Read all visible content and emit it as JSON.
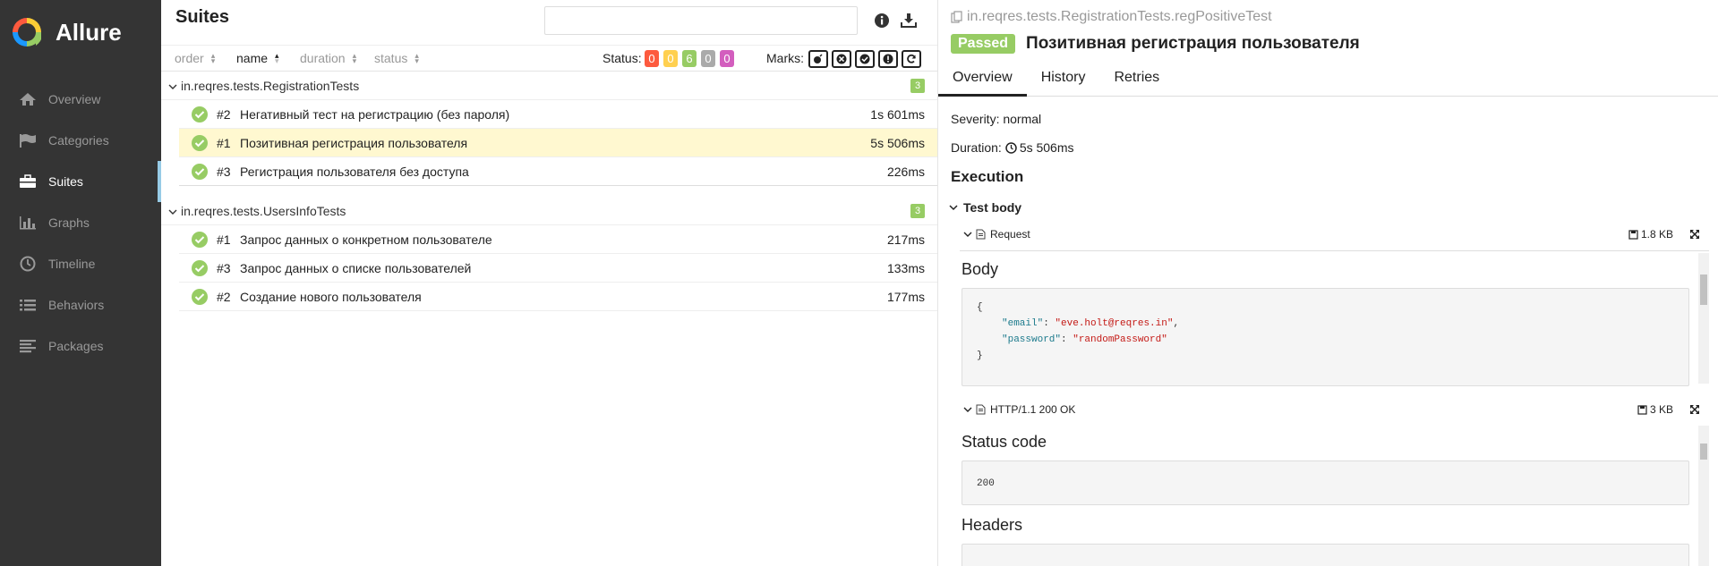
{
  "app": {
    "name": "Allure"
  },
  "sidebar": {
    "items": [
      {
        "label": "Overview",
        "icon": "home-icon"
      },
      {
        "label": "Categories",
        "icon": "flag-icon"
      },
      {
        "label": "Suites",
        "icon": "briefcase-icon",
        "active": true
      },
      {
        "label": "Graphs",
        "icon": "bar-chart-icon"
      },
      {
        "label": "Timeline",
        "icon": "clock-icon"
      },
      {
        "label": "Behaviors",
        "icon": "list-icon"
      },
      {
        "label": "Packages",
        "icon": "align-left-icon"
      }
    ]
  },
  "suites": {
    "title": "Suites",
    "search_placeholder": "",
    "sort": {
      "order": "order",
      "name": "name",
      "duration": "duration",
      "status": "status"
    },
    "status_label": "Status:",
    "counters": [
      {
        "value": "0",
        "color": "#fd5a3e"
      },
      {
        "value": "0",
        "color": "#ffd050"
      },
      {
        "value": "6",
        "color": "#97cc64"
      },
      {
        "value": "0",
        "color": "#aaaaaa"
      },
      {
        "value": "0",
        "color": "#d35ebe"
      }
    ],
    "marks_label": "Marks:",
    "groups": [
      {
        "name": "in.reqres.tests.RegistrationTests",
        "count": "3",
        "tests": [
          {
            "num": "#2",
            "name": "Негативный тест на регистрацию (без пароля)",
            "duration": "1s 601ms"
          },
          {
            "num": "#1",
            "name": "Позитивная регистрация пользователя",
            "duration": "5s 506ms"
          },
          {
            "num": "#3",
            "name": "Регистрация пользователя без доступа",
            "duration": "226ms"
          }
        ]
      },
      {
        "name": "in.reqres.tests.UsersInfoTests",
        "count": "3",
        "tests": [
          {
            "num": "#1",
            "name": "Запрос данных о конкретном пользователе",
            "duration": "217ms"
          },
          {
            "num": "#3",
            "name": "Запрос данных о списке пользователей",
            "duration": "133ms"
          },
          {
            "num": "#2",
            "name": "Создание нового пользователя",
            "duration": "177ms"
          }
        ]
      }
    ]
  },
  "detail": {
    "breadcrumb": "in.reqres.tests.RegistrationTests.regPositiveTest",
    "status": "Passed",
    "title": "Позитивная регистрация пользователя",
    "tabs": [
      "Overview",
      "History",
      "Retries"
    ],
    "severity": "Severity: normal",
    "duration_label": "Duration:",
    "duration": "5s 506ms",
    "execution": "Execution",
    "step": "Test body",
    "attachments": [
      {
        "name": "Request",
        "size": "1.8 KB",
        "section": "Body"
      },
      {
        "name": "HTTP/1.1 200 OK",
        "size": "3 KB",
        "section": "Status code",
        "value": "200",
        "section2": "Headers"
      }
    ],
    "body_lines": [
      {
        "open": "{"
      },
      {
        "key": "\"email\"",
        "sep": ": ",
        "val": "\"eve.holt@reqres.in\"",
        "end": ","
      },
      {
        "key": "\"password\"",
        "sep": ": ",
        "val": "\"randomPassword\"",
        "end": ""
      },
      {
        "close": "}"
      }
    ]
  }
}
